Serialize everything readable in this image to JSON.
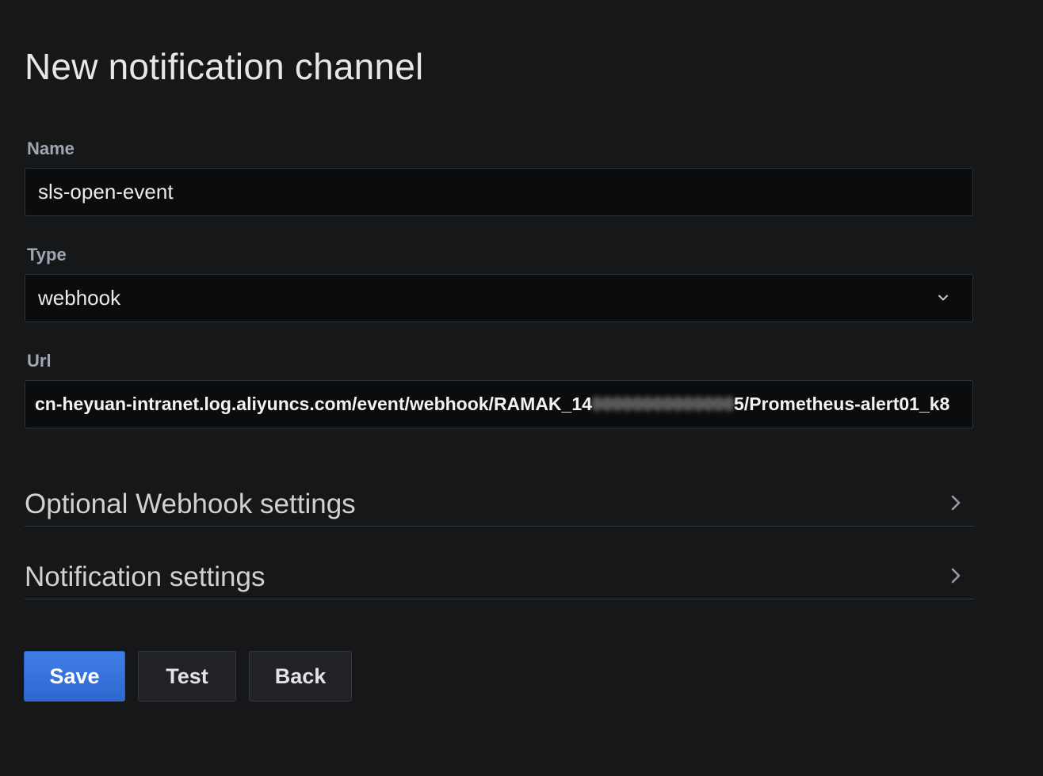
{
  "page": {
    "title": "New notification channel"
  },
  "form": {
    "name": {
      "label": "Name",
      "value": "sls-open-event"
    },
    "type": {
      "label": "Type",
      "value": "webhook"
    },
    "url": {
      "label": "Url",
      "value_prefix": "cn-heyuan-intranet.log.aliyuncs.com/event/webhook/RAMAK_14",
      "value_redacted": "00000000000000",
      "value_suffix": "5/Prometheus-alert01_k8"
    }
  },
  "sections": {
    "webhook": {
      "title": "Optional Webhook settings",
      "icon": "chevron-right-icon"
    },
    "notification": {
      "title": "Notification settings",
      "icon": "chevron-right-icon"
    }
  },
  "actions": {
    "save_label": "Save",
    "test_label": "Test",
    "back_label": "Back"
  },
  "colors": {
    "background": "#161719",
    "input_background": "#0b0c0e",
    "primary": "#3274d9",
    "text": "#d8d9da",
    "label": "#9fa7b3"
  }
}
